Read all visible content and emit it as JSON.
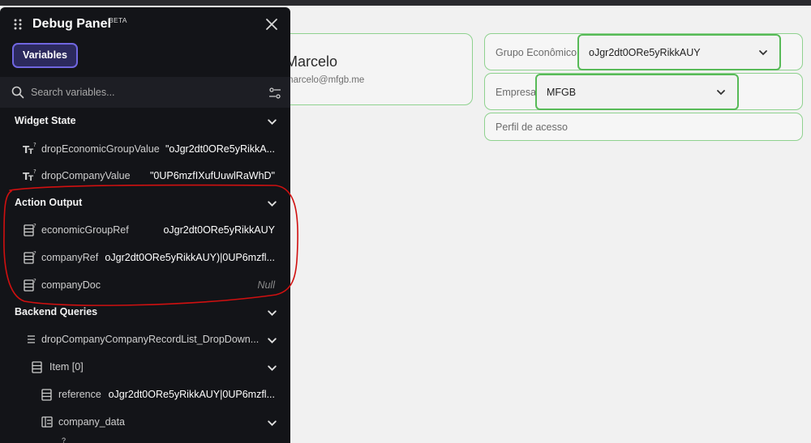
{
  "app": {
    "user": {
      "name": "Marcelo",
      "email": "marcelo@mfgb.me"
    },
    "fields": [
      {
        "label": "Grupo Econômico",
        "value": "oJgr2dt0ORe5yRikkAUY"
      },
      {
        "label": "Empresa",
        "value": "MFGB"
      },
      {
        "label": "Perfil de acesso",
        "value": ""
      }
    ]
  },
  "panel": {
    "title": "Debug Panel",
    "badge": "BETA",
    "tabs": [
      {
        "label": "Variables",
        "active": true
      }
    ],
    "search": {
      "placeholder": "Search variables..."
    },
    "sections": {
      "widget_state": {
        "title": "Widget State",
        "rows": [
          {
            "name": "dropEconomicGroupValue",
            "value": "\"oJgr2dt0ORe5yRikkA...",
            "icon": "text-type-icon"
          },
          {
            "name": "dropCompanyValue",
            "value": "\"0UP6mzfIXufUuwlRaWhD\"",
            "icon": "text-type-icon"
          }
        ]
      },
      "action_output": {
        "title": "Action Output",
        "rows": [
          {
            "name": "economicGroupRef",
            "value": "oJgr2dt0ORe5yRikkAUY",
            "icon": "document-ref-icon"
          },
          {
            "name": "companyRef",
            "value": "oJgr2dt0ORe5yRikkAUY)|0UP6mzfl...",
            "icon": "document-ref-icon"
          },
          {
            "name": "companyDoc",
            "value": "Null",
            "icon": "document-ref-icon"
          }
        ]
      },
      "backend_queries": {
        "title": "Backend Queries",
        "rows": [
          {
            "name": "dropCompanyCompanyRecordList_DropDown...",
            "value": "",
            "icon": "list-icon"
          },
          {
            "name": "Item [0]",
            "value": "",
            "icon": "document-icon"
          },
          {
            "name": "reference",
            "value": "oJgr2dt0ORe5yRikkAUY|0UP6mzfl...",
            "icon": "document-icon"
          },
          {
            "name": "company_data",
            "value": "",
            "icon": "struct-icon"
          }
        ]
      }
    }
  },
  "colors": {
    "panel_bg": "#131418",
    "accent_purple": "#7066e0",
    "field_border": "#8fd28f",
    "dropdown_border": "#57ba57",
    "annotation_red": "#d01010"
  }
}
